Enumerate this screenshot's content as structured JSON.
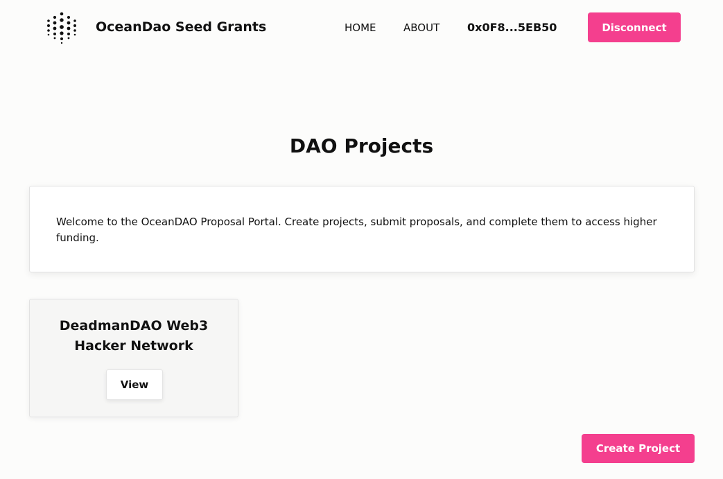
{
  "header": {
    "brand": "OceanDao Seed Grants",
    "logo_icon": "ocean-dot-logo-icon",
    "nav": {
      "home": "HOME",
      "about": "ABOUT"
    },
    "wallet_address": "0x0F8...5EB50",
    "disconnect_label": "Disconnect"
  },
  "main": {
    "title": "DAO Projects",
    "welcome_text": "Welcome to the OceanDAO Proposal Portal. Create projects, submit proposals, and complete them to access higher funding.",
    "projects": [
      {
        "title": "DeadmanDAO Web3 Hacker Network",
        "view_label": "View"
      }
    ],
    "create_label": "Create Project"
  },
  "colors": {
    "accent": "#f43f8e",
    "background": "#fcfcfb",
    "card": "#f6f6f5",
    "text": "#111111"
  }
}
